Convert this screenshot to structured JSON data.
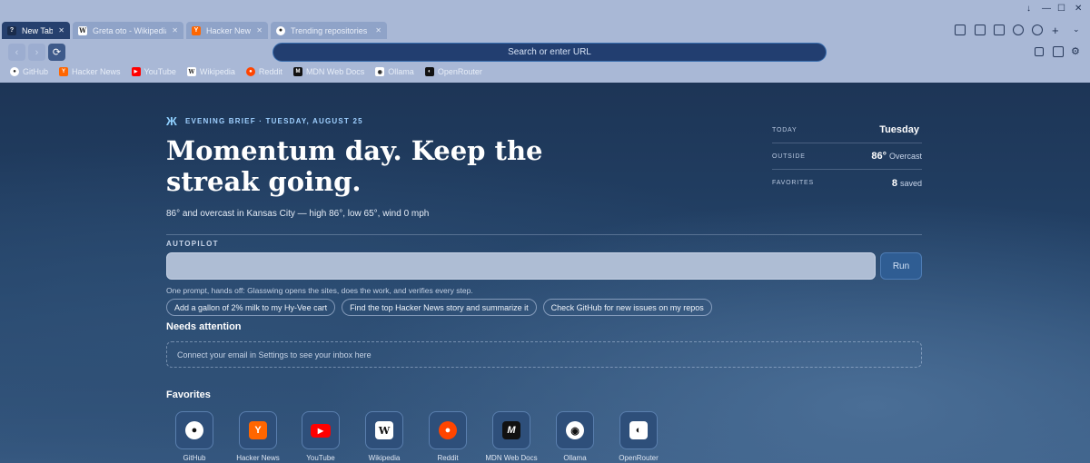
{
  "tabs": [
    {
      "label": "New Tab",
      "favicon": "question-icon",
      "active": true
    },
    {
      "label": "Greta oto - Wikipedia",
      "favicon": "wikipedia-icon"
    },
    {
      "label": "Hacker News",
      "favicon": "hackernews-icon"
    },
    {
      "label": "Trending repositories ...",
      "favicon": "github-icon"
    }
  ],
  "toolbar": {
    "url_placeholder": "Search or enter URL"
  },
  "bookmarks": [
    {
      "label": "GitHub",
      "icon": "github-icon"
    },
    {
      "label": "Hacker News",
      "icon": "hackernews-icon"
    },
    {
      "label": "YouTube",
      "icon": "youtube-icon"
    },
    {
      "label": "Wikipedia",
      "icon": "wikipedia-icon"
    },
    {
      "label": "Reddit",
      "icon": "reddit-icon"
    },
    {
      "label": "MDN Web Docs",
      "icon": "mdn-icon"
    },
    {
      "label": "Ollama",
      "icon": "ollama-icon"
    },
    {
      "label": "OpenRouter",
      "icon": "openrouter-icon"
    }
  ],
  "brief": {
    "label": "EVENING BRIEF · TUESDAY, AUGUST 25",
    "headline": "Momentum day. Keep the streak going.",
    "weather": "86° and overcast in Kansas City — high 86°, low 65°, wind 0 mph"
  },
  "stats": {
    "today_label": "TODAY",
    "today_value": "Tuesday",
    "outside_label": "OUTSIDE",
    "outside_temp": "86°",
    "outside_cond": "Overcast",
    "favorites_label": "FAVORITES",
    "favorites_count": "8",
    "favorites_suffix": "saved"
  },
  "autopilot": {
    "label": "AUTOPILOT",
    "placeholder": "",
    "run_label": "Run",
    "hint": "One prompt, hands off: Glasswing opens the sites, does the work, and verifies every step.",
    "suggestions": [
      "Add a gallon of 2% milk to my Hy-Vee cart",
      "Find the top Hacker News story and summarize it",
      "Check GitHub for new issues on my repos"
    ]
  },
  "attention": {
    "title": "Needs attention",
    "inbox_text": "Connect your email in Settings to see your inbox here"
  },
  "favorites": {
    "title": "Favorites",
    "items": [
      {
        "label": "GitHub",
        "icon": "github-icon"
      },
      {
        "label": "Hacker News",
        "icon": "hackernews-icon"
      },
      {
        "label": "YouTube",
        "icon": "youtube-icon"
      },
      {
        "label": "Wikipedia",
        "icon": "wikipedia-icon"
      },
      {
        "label": "Reddit",
        "icon": "reddit-icon"
      },
      {
        "label": "MDN Web Docs",
        "icon": "mdn-icon"
      },
      {
        "label": "Ollama",
        "icon": "ollama-icon"
      },
      {
        "label": "OpenRouter",
        "icon": "openrouter-icon"
      }
    ]
  },
  "colors": {
    "accent": "#3b6fb0",
    "hackernews": "#ff6600",
    "youtube": "#ff0000",
    "reddit": "#ff4500"
  }
}
